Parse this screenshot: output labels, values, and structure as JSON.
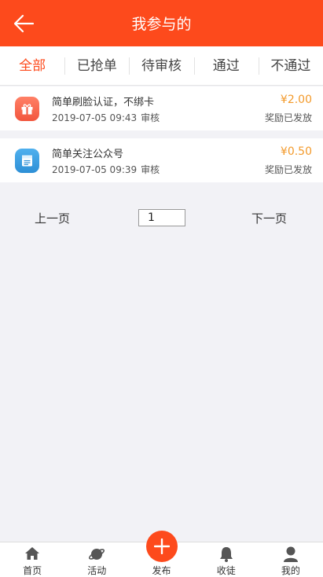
{
  "header": {
    "title": "我参与的",
    "back_icon": "arrow-left-icon",
    "bg_color": "#fd4a1c"
  },
  "tabs": [
    {
      "label": "全部",
      "active": true
    },
    {
      "label": "已抢单",
      "active": false
    },
    {
      "label": "待审核",
      "active": false
    },
    {
      "label": "通过",
      "active": false
    },
    {
      "label": "不通过",
      "active": false
    }
  ],
  "tasks": [
    {
      "title": "简单刷脸认证，不绑卡",
      "datetime": "2019-07-05 09:43",
      "status": "审核",
      "reward": "¥2.00",
      "award_status": "奖励已发放",
      "icon": "gift-icon",
      "icon_color": "#f2553d"
    },
    {
      "title": "简单关注公众号",
      "datetime": "2019-07-05 09:39",
      "status": "审核",
      "reward": "¥0.50",
      "award_status": "奖励已发放",
      "icon": "document-icon",
      "icon_color": "#2d8fd6"
    }
  ],
  "pager": {
    "prev_label": "上一页",
    "page_value": "1",
    "next_label": "下一页"
  },
  "tabbar": [
    {
      "label": "首页",
      "icon": "home-icon"
    },
    {
      "label": "活动",
      "icon": "planet-icon"
    },
    {
      "label": "发布",
      "icon": "plus-icon"
    },
    {
      "label": "收徒",
      "icon": "bell-icon"
    },
    {
      "label": "我的",
      "icon": "user-icon"
    }
  ],
  "colors": {
    "accent": "#fd4a1c",
    "price": "#f39a2b"
  }
}
